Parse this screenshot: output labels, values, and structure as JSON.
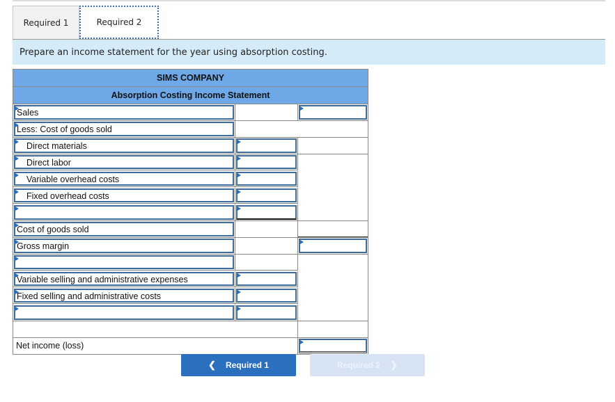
{
  "tabs": [
    {
      "label": "Required 1",
      "active": false
    },
    {
      "label": "Required 2",
      "active": true
    }
  ],
  "instruction": "Prepare an income statement for the year using absorption costing.",
  "statement": {
    "company": "SIMS COMPANY",
    "title": "Absorption Costing Income Statement",
    "rows": [
      {
        "label": "Sales",
        "mid_value": "",
        "right_value": ""
      },
      {
        "label": "Less: Cost of goods sold"
      },
      {
        "label": "Direct materials",
        "mid_value": ""
      },
      {
        "label": "Direct labor",
        "mid_value": ""
      },
      {
        "label": "Variable overhead costs",
        "mid_value": ""
      },
      {
        "label": "Fixed overhead costs",
        "mid_value": ""
      },
      {
        "label": "",
        "mid_value": ""
      },
      {
        "label": "Cost of goods sold"
      },
      {
        "label": "Gross margin",
        "right_value": ""
      },
      {
        "label": ""
      },
      {
        "label": "Variable selling and administrative expenses",
        "mid_value": ""
      },
      {
        "label": "Fixed selling and administrative costs",
        "mid_value": ""
      },
      {
        "label": "",
        "mid_value": ""
      },
      {
        "label": "Net income (loss)",
        "right_value": ""
      }
    ]
  },
  "nav": {
    "prev_label": "Required 1",
    "next_label": "Required 2",
    "prev_icon": "chevron-left-icon",
    "next_icon": "chevron-right-icon"
  },
  "colors": {
    "header_bg": "#6fa8e6",
    "instruction_bg": "#d6ebf8",
    "input_border": "#3d6b9e",
    "primary_button": "#2b6fbf",
    "disabled_button": "#d6e3f2"
  }
}
